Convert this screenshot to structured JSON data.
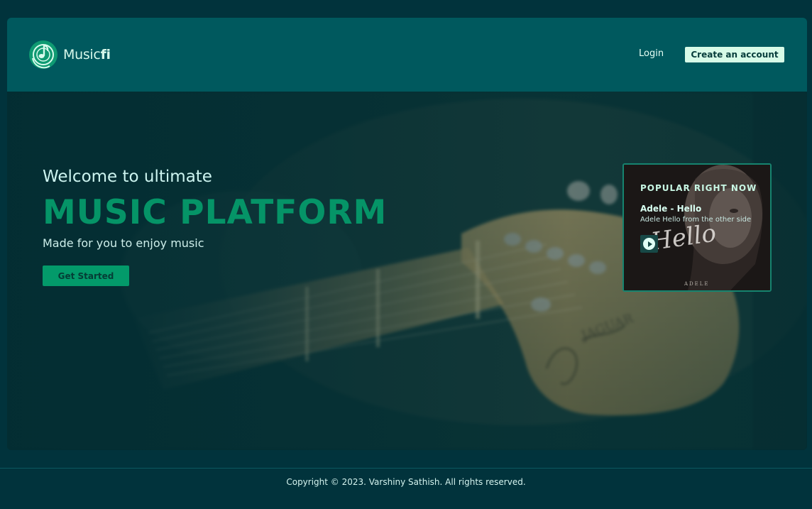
{
  "brand": {
    "name_regular": "Music",
    "name_bold": "fi",
    "logo_icon": "music-note-disc-icon"
  },
  "nav": {
    "login_label": "Login",
    "signup_label": "Create an account"
  },
  "hero": {
    "welcome": "Welcome to ultimate",
    "headline": "MUSIC PLATFORM",
    "tagline": "Made for you to enjoy music",
    "cta_label": "Get Started",
    "background_image": "blurred-electric-guitar-headstock"
  },
  "popular": {
    "title": "POPULAR RIGHT NOW",
    "song": "Adele - Hello",
    "subtitle": "Adele Hello from the other side",
    "play_icon": "play-icon",
    "cover_text": "Hello",
    "cover_artist": "ADELE"
  },
  "footer": {
    "copyright": "Copyright © 2023. Varshiny Sathish. All rights reserved."
  },
  "colors": {
    "page_bg": "#01333c",
    "navbar_bg": "#00595e",
    "accent": "#059467",
    "button_light": "#d7fbe8",
    "card_border": "#16846f"
  }
}
